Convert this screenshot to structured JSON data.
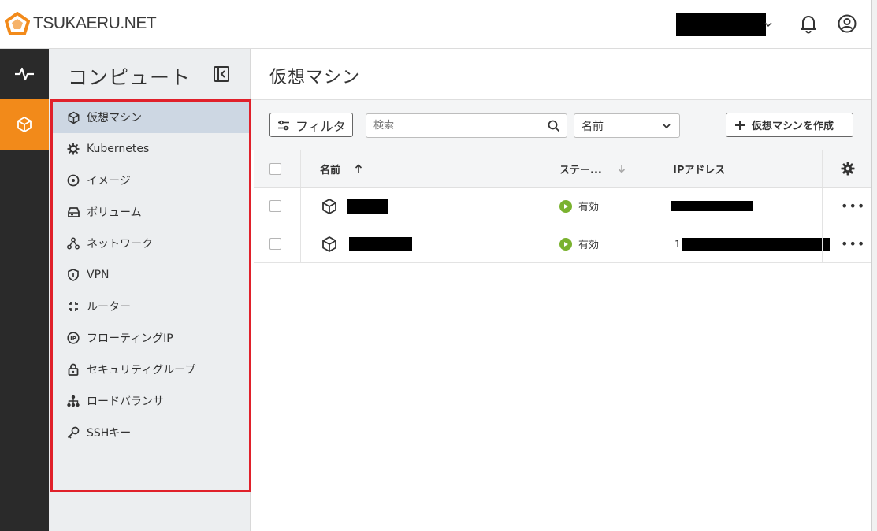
{
  "header": {
    "brand": "TSUKAERU.NET",
    "brand_color": "#f28a1a",
    "icons": [
      "chevron-down-icon",
      "bell-icon",
      "account-icon"
    ]
  },
  "rail": {
    "items": [
      {
        "icon": "activity-icon",
        "active": false
      },
      {
        "icon": "cube-icon",
        "active": true
      }
    ],
    "active_color": "#f28a1a"
  },
  "sidebar": {
    "title": "コンピュート",
    "items": [
      {
        "label": "仮想マシン",
        "icon": "cube-icon",
        "selected": true
      },
      {
        "label": "Kubernetes",
        "icon": "helm-icon"
      },
      {
        "label": "イメージ",
        "icon": "disc-icon"
      },
      {
        "label": "ボリューム",
        "icon": "drive-icon"
      },
      {
        "label": "ネットワーク",
        "icon": "network-icon"
      },
      {
        "label": "VPN",
        "icon": "shield-icon"
      },
      {
        "label": "ルーター",
        "icon": "router-icon"
      },
      {
        "label": "フローティングIP",
        "icon": "ip-icon"
      },
      {
        "label": "セキュリティグループ",
        "icon": "lock-icon"
      },
      {
        "label": "ロードバランサ",
        "icon": "sitemap-icon"
      },
      {
        "label": "SSHキー",
        "icon": "key-icon"
      }
    ],
    "highlight_color": "#e0202a"
  },
  "main": {
    "title": "仮想マシン",
    "toolbar": {
      "filter_label": "フィルタ",
      "search_placeholder": "検索",
      "sort_value": "名前",
      "create_label": "仮想マシンを作成"
    },
    "table": {
      "columns": [
        "名前",
        "ステー...",
        "IPアドレス"
      ],
      "rows": [
        {
          "name": "",
          "status": "有効",
          "ip": ""
        },
        {
          "name": "",
          "status": "有効",
          "ip": "1"
        }
      ],
      "status_color": "#7ab22f"
    }
  }
}
